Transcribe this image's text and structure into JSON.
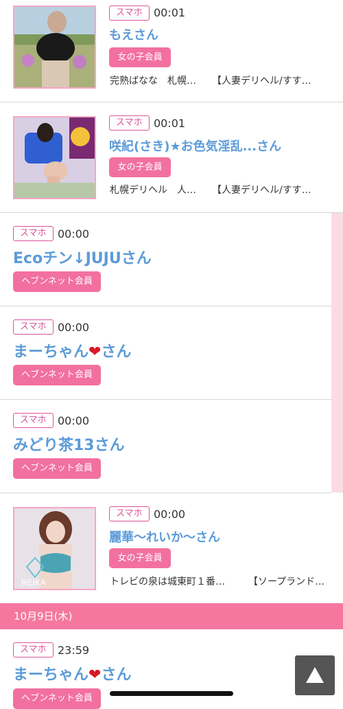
{
  "badge_label": "スマホ",
  "entries": [
    {
      "time": "00:01",
      "name": "もえさん",
      "member": "女の子会員",
      "desc1": "完熟ばなな　札幌…",
      "desc2": "【人妻デリヘル/すす…"
    },
    {
      "time": "00:01",
      "name": "咲紀(さき)★お色気淫乱...さん",
      "member": "女の子会員",
      "desc1": "札幌デリヘル　人…",
      "desc2": "【人妻デリヘル/すす…"
    },
    {
      "time": "00:00",
      "name": "Ecoチン↓JUJUさん",
      "member": "ヘブンネット会員"
    },
    {
      "time": "00:00",
      "name": "まーちゃん",
      "name_suffix": "さん",
      "member": "ヘブンネット会員"
    },
    {
      "time": "00:00",
      "name": "みどり茶13さん",
      "member": "ヘブンネット会員"
    },
    {
      "time": "00:00",
      "name": "麗華〜れいか〜さん",
      "member": "女の子会員",
      "desc1": "トレビの泉は城東町１番…",
      "desc2": "【ソープランド…"
    },
    {
      "time": "23:59",
      "name": "まーちゃん",
      "name_suffix": "さん",
      "member": "ヘブンネット会員"
    }
  ],
  "date_header": "10月9日(木)",
  "thumb_text": "REIKA",
  "colors": {
    "accent_pink": "#f2709f",
    "name_blue": "#5b9bd8",
    "badge_border": "#d9559b"
  },
  "icons": [
    "heart-icon",
    "arrow-up-icon"
  ]
}
